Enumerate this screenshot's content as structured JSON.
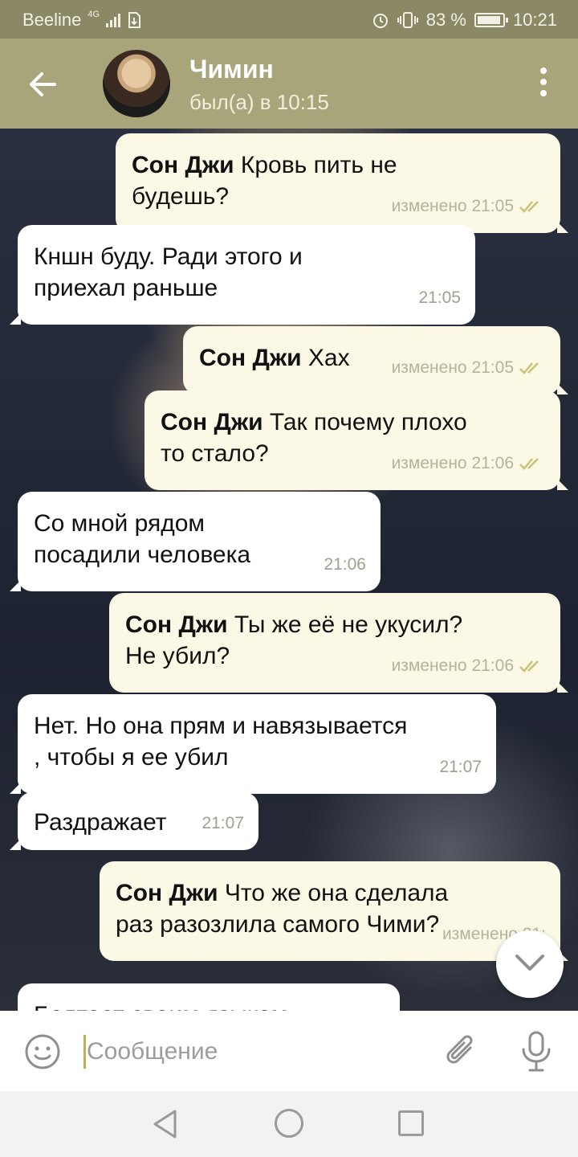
{
  "status_bar": {
    "carrier": "Beeline",
    "network": "4G",
    "battery": "83 %",
    "time": "10:21"
  },
  "header": {
    "title": "Чимин",
    "subtitle": "был(а) в 10:15"
  },
  "messages": [
    {
      "direction": "out",
      "sender": "Сон Джи",
      "text": "Кровь пить не будешь?",
      "meta": "изменено 21:05"
    },
    {
      "direction": "in",
      "sender": "",
      "text": "Кншн буду. Ради этого и приехал раньше",
      "meta": "21:05"
    },
    {
      "direction": "out",
      "sender": "Сон Джи",
      "text": "Хах",
      "meta": "изменено 21:05"
    },
    {
      "direction": "out",
      "sender": "Сон Джи",
      "text": "Так почему плохо то стало?",
      "meta": "изменено 21:06"
    },
    {
      "direction": "in",
      "sender": "",
      "text": "Со мной рядом посадили человека",
      "meta": "21:06"
    },
    {
      "direction": "out",
      "sender": "Сон Джи",
      "text": "Ты же её не укусил? Не убил?",
      "meta": "изменено 21:06"
    },
    {
      "direction": "in",
      "sender": "",
      "text": "Нет. Но она прям и навязывается , чтобы я ее убил",
      "meta": "21:07"
    },
    {
      "direction": "in",
      "sender": "",
      "text": "Раздражает",
      "meta": "21:07"
    },
    {
      "direction": "out",
      "sender": "Сон Джи",
      "text": "Что же она сделала раз разозлила самого Чими?",
      "meta": "изменено 21:"
    },
    {
      "direction": "in",
      "sender": "",
      "text": "Болтает своим языком",
      "meta": ""
    }
  ],
  "input": {
    "placeholder": "Сообщение"
  },
  "icons": {
    "back": "arrow-left-icon",
    "menu": "more-vertical-icon",
    "emoji": "smiley-icon",
    "attach": "paperclip-icon",
    "mic": "microphone-icon",
    "scroll": "chevron-down-icon"
  },
  "colors": {
    "appbar": "#a8a57a",
    "statusbar": "#8a8865",
    "incoming_bubble": "#ffffff",
    "outgoing_bubble": "#fbf8e6",
    "check_marks": "#c9c37a"
  }
}
